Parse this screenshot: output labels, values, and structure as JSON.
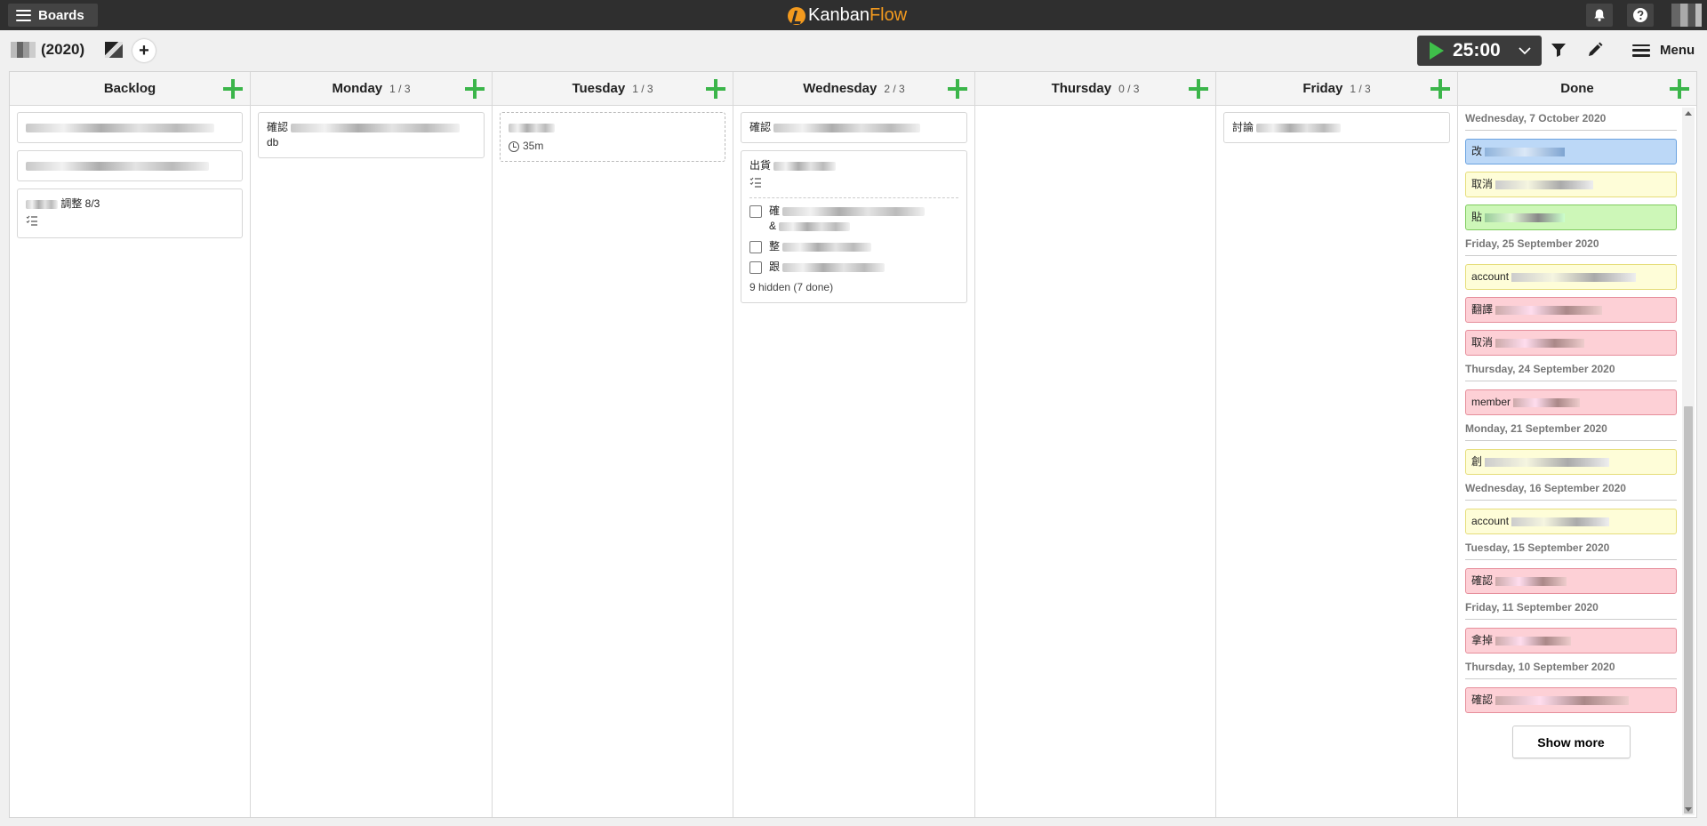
{
  "topbar": {
    "boards_label": "Boards",
    "logo_part1": "Kanban",
    "logo_part2": "Flow",
    "accent": "#f39a1e",
    "icons": [
      "notification-bell-icon",
      "help-icon"
    ]
  },
  "subbar": {
    "board_title": "(2020)",
    "add_symbol": "+",
    "timer": "25:00",
    "menu_label": "Menu"
  },
  "columns": [
    {
      "name": "Backlog",
      "wip": ""
    },
    {
      "name": "Monday",
      "wip": "1 / 3"
    },
    {
      "name": "Tuesday",
      "wip": "1 / 3"
    },
    {
      "name": "Wednesday",
      "wip": "2 / 3"
    },
    {
      "name": "Thursday",
      "wip": "0 / 3"
    },
    {
      "name": "Friday",
      "wip": "1 / 3"
    },
    {
      "name": "Done",
      "wip": ""
    }
  ],
  "cards": {
    "backlog_3_suffix": "調整 8/3",
    "monday_1_prefix": "確認",
    "monday_1_line2": "db",
    "tuesday_1_time": "35m",
    "wed_1_prefix": "確認",
    "wed_2_prefix": "出貨",
    "wed_2_sub1_prefix": "確",
    "wed_2_sub1_line2": "&",
    "wed_2_sub2_prefix": "整",
    "wed_2_sub3_prefix": "跟",
    "wed_2_hidden": "9 hidden (7 done)",
    "fri_1_prefix": "討論"
  },
  "done": {
    "groups": [
      {
        "day": "Wednesday, 7 October 2020",
        "items": [
          {
            "prefix": "改",
            "color": "blue"
          },
          {
            "prefix": "取消",
            "color": "yellow"
          },
          {
            "prefix": "貼",
            "color": "green"
          }
        ]
      },
      {
        "day": "Friday, 25 September 2020",
        "items": [
          {
            "prefix": "account",
            "color": "yellow"
          },
          {
            "prefix": "翻譯",
            "color": "pink"
          },
          {
            "prefix": "取消",
            "color": "pink"
          }
        ]
      },
      {
        "day": "Thursday, 24 September 2020",
        "items": [
          {
            "prefix": "member",
            "color": "pink"
          }
        ]
      },
      {
        "day": "Monday, 21 September 2020",
        "items": [
          {
            "prefix": "創",
            "color": "yellow"
          }
        ]
      },
      {
        "day": "Wednesday, 16 September 2020",
        "items": [
          {
            "prefix": "account",
            "color": "yellow"
          }
        ]
      },
      {
        "day": "Tuesday, 15 September 2020",
        "items": [
          {
            "prefix": "確認",
            "color": "pink"
          }
        ]
      },
      {
        "day": "Friday, 11 September 2020",
        "items": [
          {
            "prefix": "拿掉",
            "color": "pink"
          }
        ]
      },
      {
        "day": "Thursday, 10 September 2020",
        "items": [
          {
            "prefix": "確認",
            "color": "pink"
          }
        ]
      }
    ],
    "show_more": "Show more"
  },
  "colors": {
    "blue": "#bcd8f7",
    "yellow": "#fefdd8",
    "green": "#cdf7b8",
    "pink": "#fdd0d6",
    "add_green": "#3bb54a",
    "play_green": "#3fbf4a"
  }
}
